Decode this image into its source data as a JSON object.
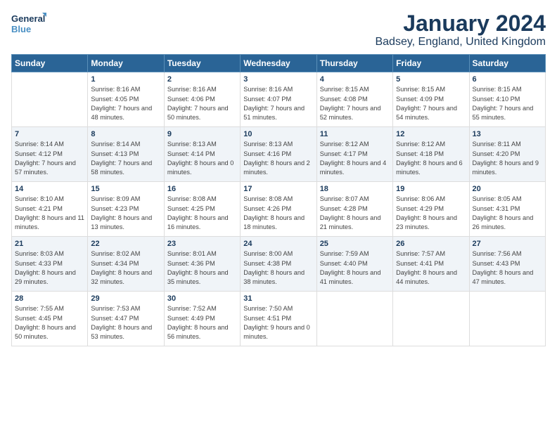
{
  "header": {
    "logo_general": "General",
    "logo_blue": "Blue",
    "month_title": "January 2024",
    "location": "Badsey, England, United Kingdom"
  },
  "days_of_week": [
    "Sunday",
    "Monday",
    "Tuesday",
    "Wednesday",
    "Thursday",
    "Friday",
    "Saturday"
  ],
  "weeks": [
    [
      {
        "day": "",
        "sunrise": "",
        "sunset": "",
        "daylight": ""
      },
      {
        "day": "1",
        "sunrise": "Sunrise: 8:16 AM",
        "sunset": "Sunset: 4:05 PM",
        "daylight": "Daylight: 7 hours and 48 minutes."
      },
      {
        "day": "2",
        "sunrise": "Sunrise: 8:16 AM",
        "sunset": "Sunset: 4:06 PM",
        "daylight": "Daylight: 7 hours and 50 minutes."
      },
      {
        "day": "3",
        "sunrise": "Sunrise: 8:16 AM",
        "sunset": "Sunset: 4:07 PM",
        "daylight": "Daylight: 7 hours and 51 minutes."
      },
      {
        "day": "4",
        "sunrise": "Sunrise: 8:15 AM",
        "sunset": "Sunset: 4:08 PM",
        "daylight": "Daylight: 7 hours and 52 minutes."
      },
      {
        "day": "5",
        "sunrise": "Sunrise: 8:15 AM",
        "sunset": "Sunset: 4:09 PM",
        "daylight": "Daylight: 7 hours and 54 minutes."
      },
      {
        "day": "6",
        "sunrise": "Sunrise: 8:15 AM",
        "sunset": "Sunset: 4:10 PM",
        "daylight": "Daylight: 7 hours and 55 minutes."
      }
    ],
    [
      {
        "day": "7",
        "sunrise": "Sunrise: 8:14 AM",
        "sunset": "Sunset: 4:12 PM",
        "daylight": "Daylight: 7 hours and 57 minutes."
      },
      {
        "day": "8",
        "sunrise": "Sunrise: 8:14 AM",
        "sunset": "Sunset: 4:13 PM",
        "daylight": "Daylight: 7 hours and 58 minutes."
      },
      {
        "day": "9",
        "sunrise": "Sunrise: 8:13 AM",
        "sunset": "Sunset: 4:14 PM",
        "daylight": "Daylight: 8 hours and 0 minutes."
      },
      {
        "day": "10",
        "sunrise": "Sunrise: 8:13 AM",
        "sunset": "Sunset: 4:16 PM",
        "daylight": "Daylight: 8 hours and 2 minutes."
      },
      {
        "day": "11",
        "sunrise": "Sunrise: 8:12 AM",
        "sunset": "Sunset: 4:17 PM",
        "daylight": "Daylight: 8 hours and 4 minutes."
      },
      {
        "day": "12",
        "sunrise": "Sunrise: 8:12 AM",
        "sunset": "Sunset: 4:18 PM",
        "daylight": "Daylight: 8 hours and 6 minutes."
      },
      {
        "day": "13",
        "sunrise": "Sunrise: 8:11 AM",
        "sunset": "Sunset: 4:20 PM",
        "daylight": "Daylight: 8 hours and 9 minutes."
      }
    ],
    [
      {
        "day": "14",
        "sunrise": "Sunrise: 8:10 AM",
        "sunset": "Sunset: 4:21 PM",
        "daylight": "Daylight: 8 hours and 11 minutes."
      },
      {
        "day": "15",
        "sunrise": "Sunrise: 8:09 AM",
        "sunset": "Sunset: 4:23 PM",
        "daylight": "Daylight: 8 hours and 13 minutes."
      },
      {
        "day": "16",
        "sunrise": "Sunrise: 8:08 AM",
        "sunset": "Sunset: 4:25 PM",
        "daylight": "Daylight: 8 hours and 16 minutes."
      },
      {
        "day": "17",
        "sunrise": "Sunrise: 8:08 AM",
        "sunset": "Sunset: 4:26 PM",
        "daylight": "Daylight: 8 hours and 18 minutes."
      },
      {
        "day": "18",
        "sunrise": "Sunrise: 8:07 AM",
        "sunset": "Sunset: 4:28 PM",
        "daylight": "Daylight: 8 hours and 21 minutes."
      },
      {
        "day": "19",
        "sunrise": "Sunrise: 8:06 AM",
        "sunset": "Sunset: 4:29 PM",
        "daylight": "Daylight: 8 hours and 23 minutes."
      },
      {
        "day": "20",
        "sunrise": "Sunrise: 8:05 AM",
        "sunset": "Sunset: 4:31 PM",
        "daylight": "Daylight: 8 hours and 26 minutes."
      }
    ],
    [
      {
        "day": "21",
        "sunrise": "Sunrise: 8:03 AM",
        "sunset": "Sunset: 4:33 PM",
        "daylight": "Daylight: 8 hours and 29 minutes."
      },
      {
        "day": "22",
        "sunrise": "Sunrise: 8:02 AM",
        "sunset": "Sunset: 4:34 PM",
        "daylight": "Daylight: 8 hours and 32 minutes."
      },
      {
        "day": "23",
        "sunrise": "Sunrise: 8:01 AM",
        "sunset": "Sunset: 4:36 PM",
        "daylight": "Daylight: 8 hours and 35 minutes."
      },
      {
        "day": "24",
        "sunrise": "Sunrise: 8:00 AM",
        "sunset": "Sunset: 4:38 PM",
        "daylight": "Daylight: 8 hours and 38 minutes."
      },
      {
        "day": "25",
        "sunrise": "Sunrise: 7:59 AM",
        "sunset": "Sunset: 4:40 PM",
        "daylight": "Daylight: 8 hours and 41 minutes."
      },
      {
        "day": "26",
        "sunrise": "Sunrise: 7:57 AM",
        "sunset": "Sunset: 4:41 PM",
        "daylight": "Daylight: 8 hours and 44 minutes."
      },
      {
        "day": "27",
        "sunrise": "Sunrise: 7:56 AM",
        "sunset": "Sunset: 4:43 PM",
        "daylight": "Daylight: 8 hours and 47 minutes."
      }
    ],
    [
      {
        "day": "28",
        "sunrise": "Sunrise: 7:55 AM",
        "sunset": "Sunset: 4:45 PM",
        "daylight": "Daylight: 8 hours and 50 minutes."
      },
      {
        "day": "29",
        "sunrise": "Sunrise: 7:53 AM",
        "sunset": "Sunset: 4:47 PM",
        "daylight": "Daylight: 8 hours and 53 minutes."
      },
      {
        "day": "30",
        "sunrise": "Sunrise: 7:52 AM",
        "sunset": "Sunset: 4:49 PM",
        "daylight": "Daylight: 8 hours and 56 minutes."
      },
      {
        "day": "31",
        "sunrise": "Sunrise: 7:50 AM",
        "sunset": "Sunset: 4:51 PM",
        "daylight": "Daylight: 9 hours and 0 minutes."
      },
      {
        "day": "",
        "sunrise": "",
        "sunset": "",
        "daylight": ""
      },
      {
        "day": "",
        "sunrise": "",
        "sunset": "",
        "daylight": ""
      },
      {
        "day": "",
        "sunrise": "",
        "sunset": "",
        "daylight": ""
      }
    ]
  ]
}
